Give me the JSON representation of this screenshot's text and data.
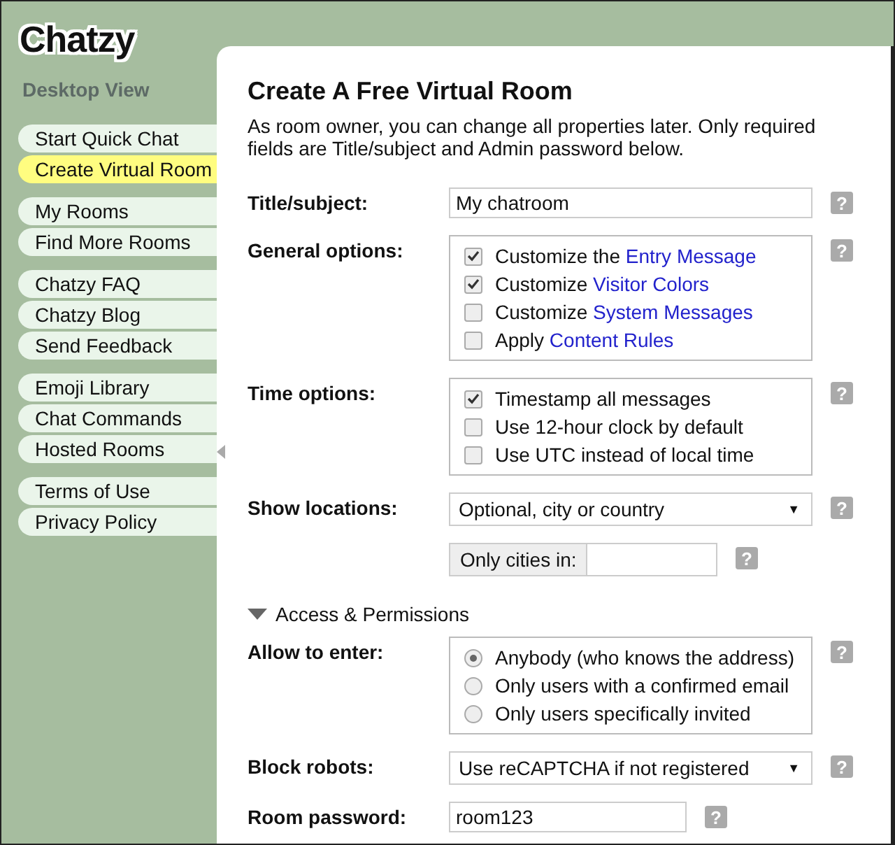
{
  "logo": "Chatzy",
  "view_label": "Desktop View",
  "sidebar": {
    "groups": [
      {
        "items": [
          {
            "label": "Start Quick Chat",
            "selected": false
          },
          {
            "label": "Create Virtual Room",
            "selected": true
          }
        ]
      },
      {
        "items": [
          {
            "label": "My Rooms",
            "selected": false
          },
          {
            "label": "Find More Rooms",
            "selected": false
          }
        ]
      },
      {
        "items": [
          {
            "label": "Chatzy FAQ",
            "selected": false
          },
          {
            "label": "Chatzy Blog",
            "selected": false
          },
          {
            "label": "Send Feedback",
            "selected": false
          }
        ]
      },
      {
        "items": [
          {
            "label": "Emoji Library",
            "selected": false
          },
          {
            "label": "Chat Commands",
            "selected": false
          },
          {
            "label": "Hosted Rooms",
            "selected": false
          }
        ]
      },
      {
        "items": [
          {
            "label": "Terms of Use",
            "selected": false
          },
          {
            "label": "Privacy Policy",
            "selected": false
          }
        ]
      }
    ]
  },
  "heading": "Create A Free Virtual Room",
  "intro": "As room owner, you can change all properties later. Only required fields are Title/subject and Admin password below.",
  "rows": [
    {
      "kind": "text",
      "label": "Title/subject:",
      "value": "My chatroom",
      "help": "?"
    },
    {
      "kind": "checks",
      "label": "General options:",
      "help": "?",
      "options": [
        {
          "text": "Customize the",
          "link": "Entry Message",
          "checked": true
        },
        {
          "text": "Customize",
          "link": "Visitor Colors",
          "checked": true
        },
        {
          "text": "Customize",
          "link": "System Messages",
          "checked": false
        },
        {
          "text": "Apply",
          "link": "Content Rules",
          "checked": false
        }
      ]
    },
    {
      "kind": "checks",
      "label": "Time options:",
      "help": "?",
      "options": [
        {
          "text": "Timestamp all messages",
          "checked": true
        },
        {
          "text": "Use 12-hour clock by default",
          "checked": false
        },
        {
          "text": "Use UTC instead of local time",
          "checked": false
        }
      ]
    },
    {
      "kind": "select",
      "label": "Show locations:",
      "value": "Optional, city or country",
      "caret": "▼",
      "help": "?"
    },
    {
      "kind": "prefixed",
      "prefix": "Only cities in:",
      "help": "?"
    },
    {
      "kind": "section",
      "label": "Access & Permissions",
      "expanded": true
    },
    {
      "kind": "radios",
      "label": "Allow to enter:",
      "help": "?",
      "options": [
        {
          "text": "Anybody (who knows the address)",
          "selected": true
        },
        {
          "text": "Only users with a confirmed email",
          "selected": false
        },
        {
          "text": "Only users specifically invited",
          "selected": false
        }
      ]
    },
    {
      "kind": "select",
      "label": "Block robots:",
      "value": "Use reCAPTCHA if not registered",
      "caret": "▼",
      "help": "?"
    },
    {
      "kind": "short",
      "label": "Room password:",
      "value": "room123",
      "help": "?"
    }
  ]
}
